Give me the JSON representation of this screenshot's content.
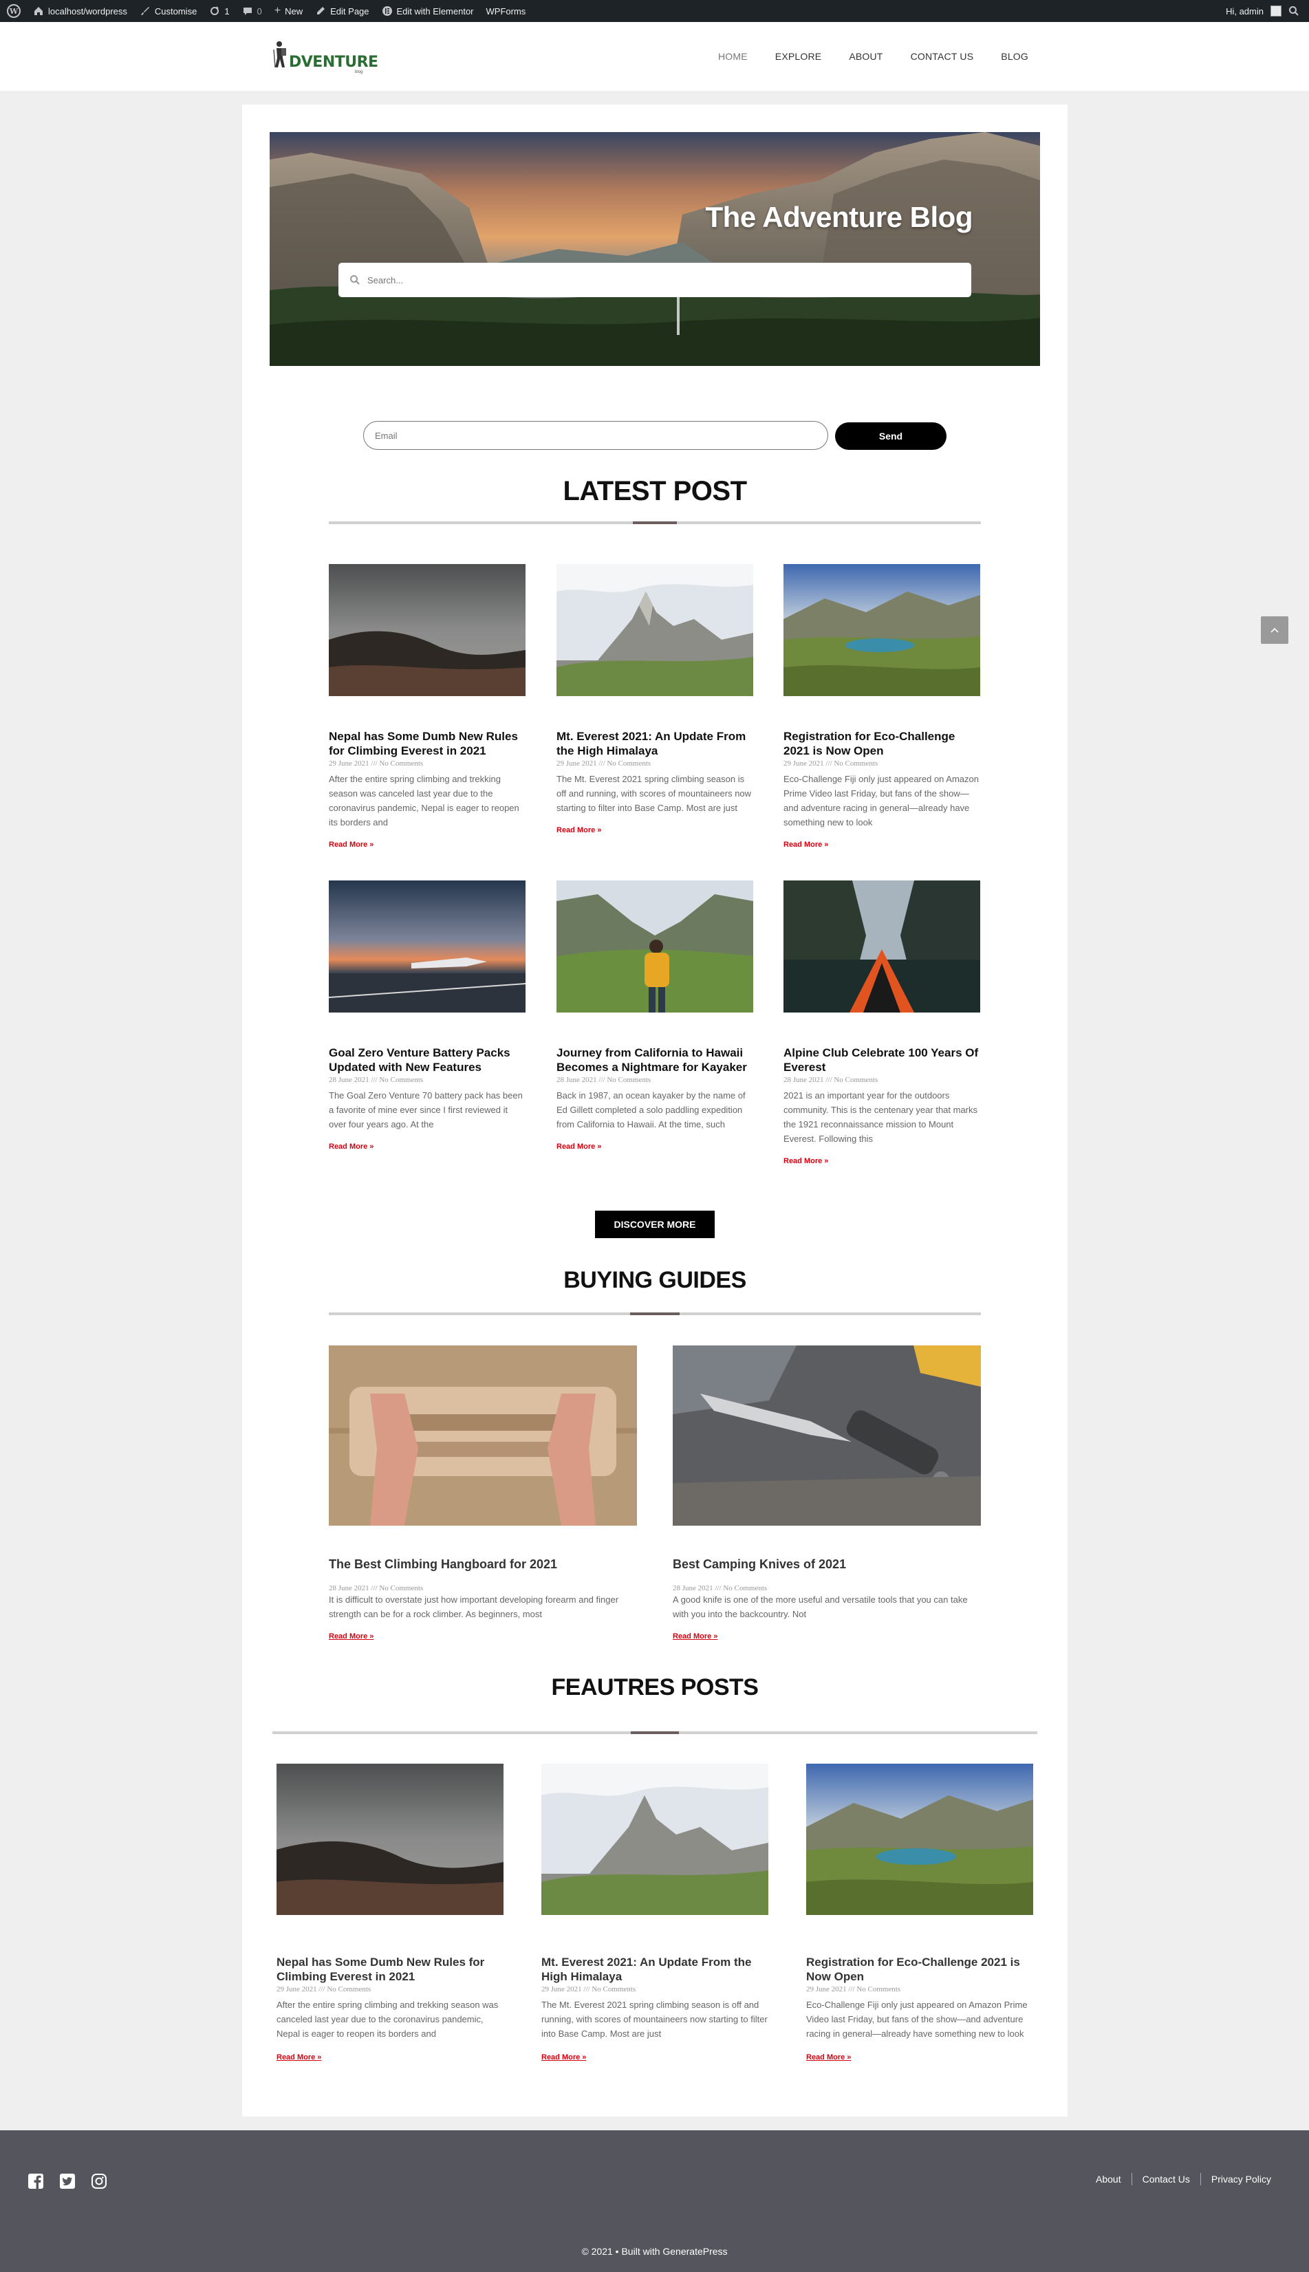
{
  "adminbar": {
    "site": "localhost/wordpress",
    "customise": "Customise",
    "updates": "1",
    "comments": "0",
    "new": "New",
    "edit_page": "Edit Page",
    "elementor": "Edit with Elementor",
    "wpforms": "WPForms",
    "greeting": "Hi, admin"
  },
  "header": {
    "logo_text": "DVENTURE",
    "logo_sub": "blog",
    "nav": [
      "HOME",
      "EXPLORE",
      "ABOUT",
      "CONTACT US",
      "BLOG"
    ]
  },
  "hero": {
    "title": "The Adventure Blog",
    "search_placeholder": "Search..."
  },
  "newsletter": {
    "email_placeholder": "Email",
    "button": "Send"
  },
  "latest": {
    "title": "LATEST POST",
    "posts": [
      {
        "title": "Nepal has Some Dumb New Rules for Climbing Everest in 2021",
        "meta": "29 June 2021 /// No Comments",
        "excerpt": "After the entire spring climbing and trekking season was canceled last year due to the coronavirus pandemic, Nepal is eager to reopen its borders and",
        "more": "Read More »"
      },
      {
        "title": "Mt. Everest 2021: An Update From the High Himalaya",
        "meta": "29 June 2021 /// No Comments",
        "excerpt": "The Mt. Everest 2021 spring climbing season is off and running, with scores of mountaineers now starting to filter into Base Camp. Most are just",
        "more": "Read More »"
      },
      {
        "title": "Registration for Eco-Challenge 2021 is Now Open",
        "meta": "29 June 2021 /// No Comments",
        "excerpt": "Eco-Challenge Fiji only just appeared on Amazon Prime Video last Friday, but fans of the show—and adventure racing in general—already have something new to look",
        "more": "Read More »"
      },
      {
        "title": "Goal Zero Venture Battery Packs Updated with New Features",
        "meta": "28 June 2021 /// No Comments",
        "excerpt": "The Goal Zero Venture 70 battery pack has been a favorite of mine ever since I first reviewed it over four years ago. At the",
        "more": "Read More »"
      },
      {
        "title": "Journey from California to Hawaii Becomes a Nightmare for Kayaker",
        "meta": "28 June 2021 /// No Comments",
        "excerpt": "Back in 1987, an ocean kayaker by the name of Ed Gillett completed a solo paddling expedition from California to Hawaii. At the time, such",
        "more": "Read More »"
      },
      {
        "title": "Alpine Club Celebrate 100 Years Of Everest",
        "meta": "28 June 2021 /// No Comments",
        "excerpt": "2021 is an important year for the outdoors community. This is the centenary year that marks the 1921 reconnaissance mission to Mount Everest. Following this",
        "more": "Read More »"
      }
    ],
    "discover": "DISCOVER MORE"
  },
  "guides": {
    "title": "BUYING GUIDES",
    "posts": [
      {
        "title": "The Best Climbing Hangboard for 2021",
        "meta": "28 June 2021 /// No Comments",
        "excerpt": "It is difficult to overstate just how important developing forearm and finger strength can be for a rock climber. As beginners, most",
        "more": "Read More »"
      },
      {
        "title": "Best Camping Knives of 2021",
        "meta": "28 June 2021 /// No Comments",
        "excerpt": "A good knife is one of the more useful and versatile tools that you can take with you into the backcountry. Not",
        "more": "Read More »"
      }
    ]
  },
  "featured": {
    "title": "FEAUTRES POSTS",
    "posts": [
      {
        "title": "Nepal has Some Dumb New Rules for Climbing Everest in 2021",
        "meta": "29 June 2021 /// No Comments",
        "excerpt": "After the entire spring climbing and trekking season was canceled last year due to the coronavirus pandemic, Nepal is eager to reopen its borders and",
        "more": "Read More »"
      },
      {
        "title": "Mt. Everest 2021: An Update From the High Himalaya",
        "meta": "29 June 2021 /// No Comments",
        "excerpt": "The Mt. Everest 2021 spring climbing season is off and running, with scores of mountaineers now starting to filter into Base Camp. Most are just",
        "more": "Read More »"
      },
      {
        "title": "Registration for Eco-Challenge 2021 is Now Open",
        "meta": "29 June 2021 /// No Comments",
        "excerpt": "Eco-Challenge Fiji only just appeared on Amazon Prime Video last Friday, but fans of the show—and adventure racing in general—already have something new to look",
        "more": "Read More »"
      }
    ]
  },
  "footer": {
    "social_icons": [
      "facebook-icon",
      "twitter-icon",
      "instagram-icon"
    ],
    "links": [
      "About",
      "Contact Us",
      "Privacy Policy"
    ],
    "copyright": "© 2021 • Built with GeneratePress"
  },
  "colors": {
    "adminbar": "#1d2327",
    "read_more": "#d7000e",
    "footer_bg": "#55555e",
    "logo_green": "#2a6e34"
  }
}
